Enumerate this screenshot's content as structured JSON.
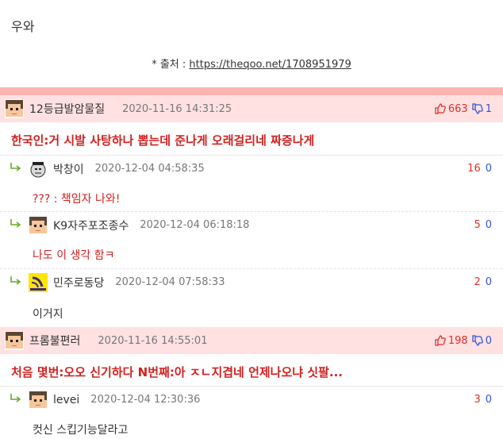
{
  "post": {
    "text": "우와",
    "source_prefix": "* 출처 : ",
    "source_link": "https://theqoo.net/1708951979"
  },
  "comments": [
    {
      "nick": "12등급발암물질",
      "date": "2020-11-16 14:31:25",
      "up": "663",
      "down": "1",
      "content": "한국인:거 시발 사탕하나 뽑는데 준나게 오래걸리네 짜증나게",
      "replies": [
        {
          "nick": "박창이",
          "date": "2020-12-04 04:58:35",
          "up": "16",
          "down": "0",
          "content": "??? : 책임자 나와!"
        },
        {
          "nick": "K9자주포조종수",
          "date": "2020-12-04 06:18:18",
          "up": "5",
          "down": "0",
          "content": "나도 이 생각 함ㅋ"
        },
        {
          "nick": "민주로동당",
          "date": "2020-12-04 07:58:33",
          "up": "2",
          "down": "0",
          "content": "이거지"
        }
      ]
    },
    {
      "nick": "프롬불편러",
      "date": "2020-11-16 14:55:01",
      "up": "198",
      "down": "0",
      "content": "처음 몇번:오오 신기하다 N번째:아 ㅈㄴ지겹네 언제나오냐 싯팔...",
      "replies": [
        {
          "nick": "levei",
          "date": "2020-12-04 12:30:36",
          "up": "3",
          "down": "0",
          "content": "컷신 스킵기능달라고"
        }
      ]
    }
  ],
  "icons": {
    "reply_arrow": "reply-arrow-icon",
    "thumb_up": "thumbs-up-icon",
    "thumb_down": "thumbs-down-icon"
  },
  "colors": {
    "best_bg": "#ffe1e1",
    "bar": "#ffb3b3",
    "red": "#d42020",
    "blue": "#3355cc"
  }
}
